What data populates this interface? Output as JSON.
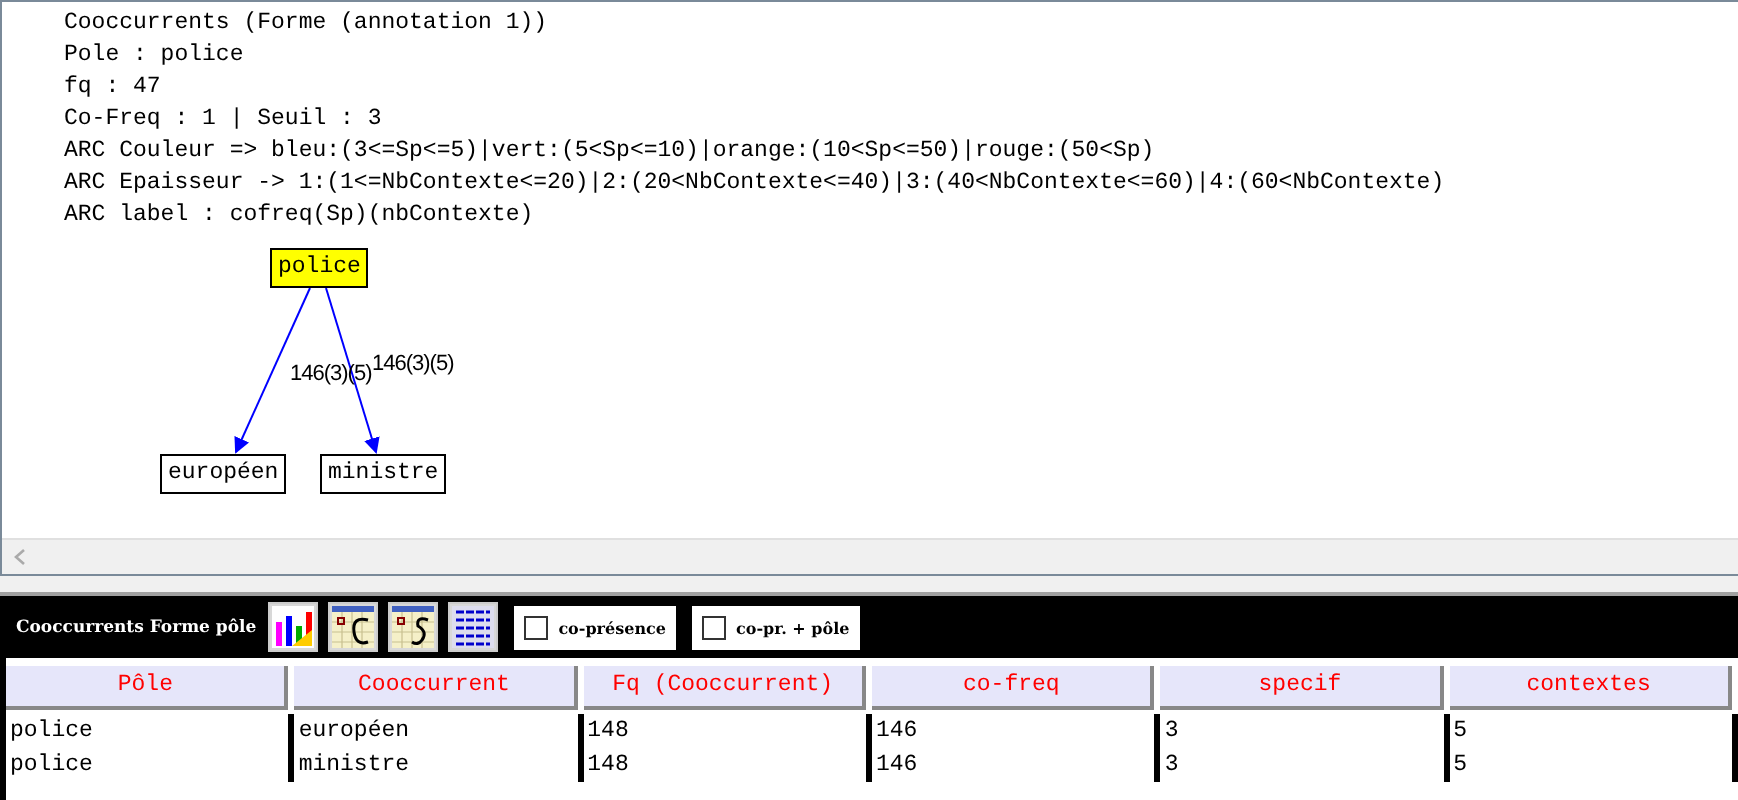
{
  "info_lines": [
    "Cooccurrents (Forme (annotation 1))",
    "Pole : police",
    "fq : 47",
    "Co-Freq : 1 | Seuil : 3",
    "ARC Couleur => bleu:(3<=Sp<=5)|vert:(5<Sp<=10)|orange:(10<Sp<=50)|rouge:(50<Sp)",
    "ARC Epaisseur -> 1:(1<=NbContexte<=20)|2:(20<NbContexte<=40)|3:(40<NbContexte<=60)|4:(60<NbContexte)",
    "ARC label : cofreq(Sp)(nbContexte)"
  ],
  "graph": {
    "pole": {
      "label": "police"
    },
    "cooccurrents": [
      {
        "label": "européen",
        "edge_label": "146(3)(5)"
      },
      {
        "label": "ministre",
        "edge_label": "146(3)(5)"
      }
    ]
  },
  "toolbar": {
    "title": "Cooccurrents Forme pôle",
    "checkboxes": [
      {
        "label": "co-présence",
        "checked": false
      },
      {
        "label": "co-pr. + pôle",
        "checked": false
      }
    ]
  },
  "table": {
    "columns": [
      "Pôle",
      "Cooccurrent",
      "Fq (Cooccurrent)",
      "co-freq",
      "specif",
      "contextes"
    ],
    "rows": [
      [
        "police",
        "européen",
        "148",
        "146",
        "3",
        "5"
      ],
      [
        "police",
        "ministre",
        "148",
        "146",
        "3",
        "5"
      ]
    ]
  }
}
